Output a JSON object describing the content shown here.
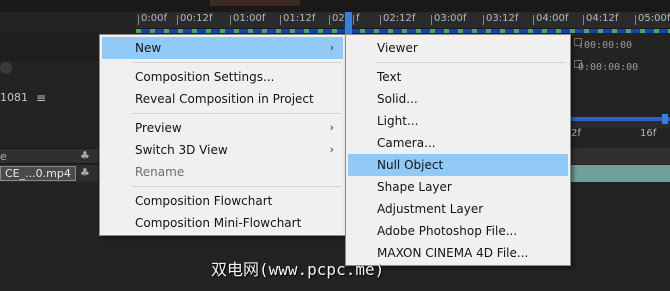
{
  "timeline": {
    "ruler_ticks": [
      "0:00f",
      "00:12f",
      "01:00f",
      "01:12f",
      "02:",
      "f",
      "02:12f",
      "03:00f",
      "03:12f",
      "04:00f",
      "04:12f",
      "05:00f"
    ],
    "timecode_right": ":00:00:00",
    "timecode_right2": "0:00:00:00",
    "ruler2_ticks": [
      "2f",
      "16f"
    ]
  },
  "left_panel": {
    "label": "1081",
    "menu_icon": "≡",
    "header_col2": "♣",
    "layer_name": "CE_...0.mp4",
    "layer_col2": "♣"
  },
  "context_menu": {
    "items": [
      {
        "label": "New",
        "submenu": true,
        "highlighted": true
      },
      {
        "separator": true
      },
      {
        "label": "Composition Settings..."
      },
      {
        "label": "Reveal Composition in Project"
      },
      {
        "separator": true
      },
      {
        "label": "Preview",
        "submenu": true
      },
      {
        "label": "Switch 3D View",
        "submenu": true
      },
      {
        "label": "Rename",
        "disabled": true
      },
      {
        "separator": true
      },
      {
        "label": "Composition Flowchart"
      },
      {
        "label": "Composition Mini-Flowchart"
      }
    ]
  },
  "new_submenu": {
    "items": [
      {
        "label": "Viewer"
      },
      {
        "separator": true
      },
      {
        "label": "Text"
      },
      {
        "label": "Solid..."
      },
      {
        "label": "Light..."
      },
      {
        "label": "Camera..."
      },
      {
        "label": "Null Object",
        "highlighted": true
      },
      {
        "label": "Shape Layer"
      },
      {
        "label": "Adjustment Layer"
      },
      {
        "label": "Adobe Photoshop File..."
      },
      {
        "label": "MAXON CINEMA 4D File..."
      }
    ]
  },
  "watermark": "双电网(www.pcpc.me)",
  "colors": {
    "menu_bg": "#f0f0f0",
    "highlight": "#91c9f7",
    "timeline_blue": "#1c3fb8",
    "layer_bar": "#6f9f97"
  }
}
